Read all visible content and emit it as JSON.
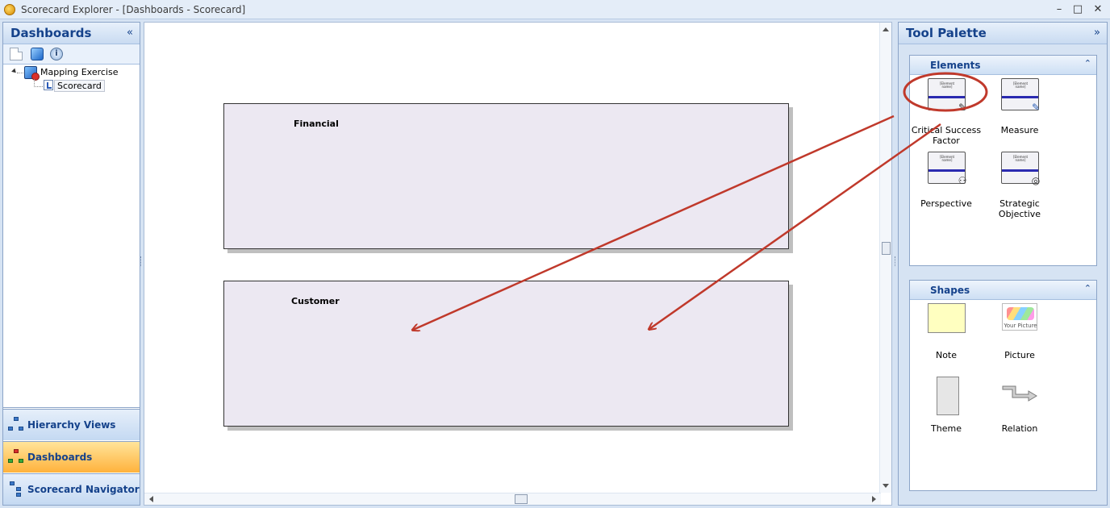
{
  "window": {
    "title": "Scorecard Explorer - [Dashboards - Scorecard]",
    "minimize": "–",
    "maximize": "□",
    "close": "✕"
  },
  "left_panel": {
    "title": "Dashboards",
    "collapse_glyph": "«",
    "toolbar": {
      "icons": [
        "new-document-icon",
        "cube-icon",
        "info-icon"
      ],
      "info_glyph": "i"
    },
    "tree": {
      "root": "Mapping Exercise",
      "child": "Scorecard"
    },
    "nav": {
      "hierarchy_views": "Hierarchy Views",
      "dashboards": "Dashboards",
      "scorecard_navigator": "Scorecard Navigator"
    }
  },
  "canvas": {
    "perspectives": [
      {
        "label": "Financial"
      },
      {
        "label": "Customer"
      }
    ]
  },
  "tool_palette": {
    "title": "Tool Palette",
    "collapse_glyph": "»",
    "elements": {
      "title": "Elements",
      "collapse_glyph": "⌃",
      "mini_text": "[Element name]",
      "items": [
        {
          "label": "Critical Success Factor",
          "icon": "wrench-icon",
          "glyph": "✎"
        },
        {
          "label": "Measure",
          "icon": "ruler-icon",
          "glyph": "✎"
        },
        {
          "label": "Perspective",
          "icon": "binoculars-icon",
          "glyph": "⚇"
        },
        {
          "label": "Strategic Objective",
          "icon": "target-icon",
          "glyph": "◎"
        }
      ]
    },
    "shapes": {
      "title": "Shapes",
      "collapse_glyph": "⌃",
      "picture_text": "Your Picture",
      "items": [
        {
          "label": "Note",
          "icon": "note-icon"
        },
        {
          "label": "Picture",
          "icon": "picture-icon"
        },
        {
          "label": "Theme",
          "icon": "theme-icon"
        },
        {
          "label": "Relation",
          "icon": "relation-arrow-icon"
        }
      ]
    }
  },
  "colors": {
    "annotation": "#c0392b",
    "accent_blue": "#15428b",
    "selected_nav": "#ffb23c",
    "perspective_fill": "#ece8f2"
  }
}
